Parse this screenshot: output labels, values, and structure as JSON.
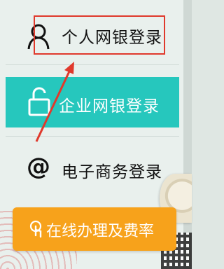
{
  "login_menu": {
    "personal": {
      "label": "个人网银登录",
      "icon": "person-icon"
    },
    "enterprise": {
      "label": "企业网银登录",
      "icon": "unlock-icon"
    },
    "ebiz": {
      "label": "电子商务登录",
      "icon": "at-sign-icon",
      "glyph": "@"
    }
  },
  "rate_button": {
    "label": "在线办理及费率",
    "icon": "hand-cursor-icon"
  },
  "annotation": {
    "highlight_color": "#e0392c",
    "arrow_color": "#e0392c"
  },
  "colors": {
    "enterprise_bg": "#26c7bd",
    "rate_button_bg": "#f7a21b"
  }
}
